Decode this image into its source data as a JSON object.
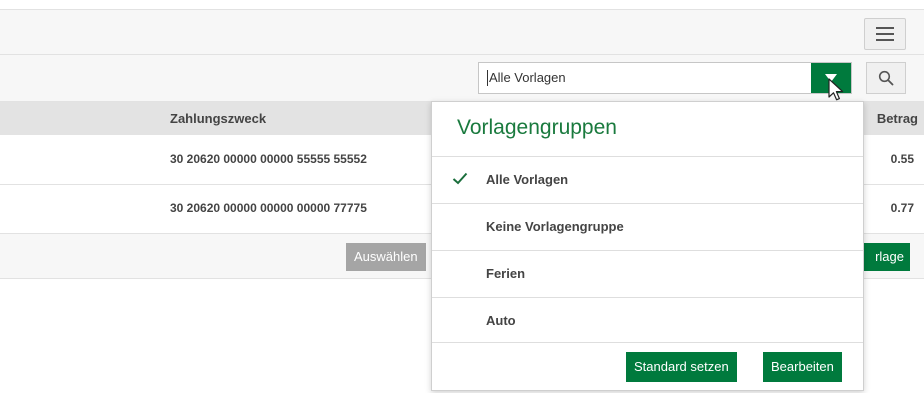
{
  "toolbar": {
    "menu_icon": "hamburger-icon"
  },
  "filter": {
    "selected": "Alle Vorlagen",
    "toggle_icon": "chevron-down-icon",
    "search_icon": "search-icon"
  },
  "table": {
    "columns": [
      "Zahlungszweck",
      "Betrag"
    ],
    "rows": [
      {
        "zweck": "30 20620 00000 00000 55555 55552",
        "betrag": "0.55"
      },
      {
        "zweck": "30 20620 00000 00000 00000 77775",
        "betrag": "0.77"
      }
    ]
  },
  "actions": {
    "select_label": "Auswählen",
    "new_label_partial": "rlage"
  },
  "dropdown": {
    "title": "Vorlagengruppen",
    "items": [
      {
        "label": "Alle Vorlagen",
        "checked": true
      },
      {
        "label": "Keine Vorlagengruppe",
        "checked": false
      },
      {
        "label": "Ferien",
        "checked": false
      },
      {
        "label": "Auto",
        "checked": false
      }
    ],
    "set_default_label": "Standard setzen",
    "edit_label": "Bearbeiten"
  },
  "colors": {
    "accent_green": "#007a3d",
    "title_green": "#1a7a3e",
    "header_grey": "#e3e3e3",
    "disabled_grey": "#a5a5a5"
  }
}
